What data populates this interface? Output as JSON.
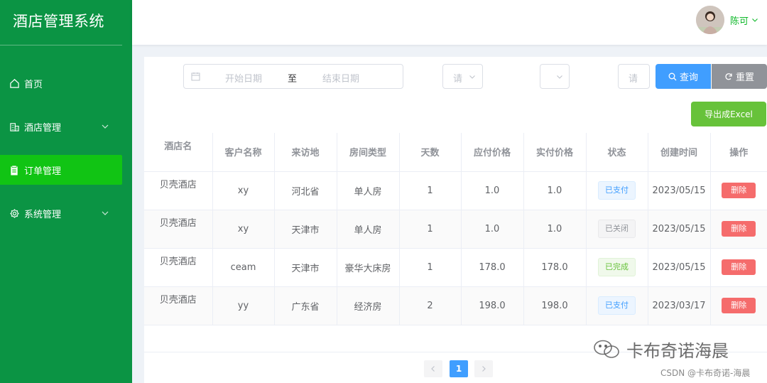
{
  "app": {
    "title": "酒店管理系统"
  },
  "sidebar": {
    "items": [
      {
        "label": "首页",
        "icon": "home-icon",
        "active": false,
        "expandable": false
      },
      {
        "label": "酒店管理",
        "icon": "building-icon",
        "active": false,
        "expandable": true
      },
      {
        "label": "订单管理",
        "icon": "clipboard-icon",
        "active": true,
        "expandable": false
      },
      {
        "label": "系统管理",
        "icon": "gear-icon",
        "active": false,
        "expandable": true
      }
    ]
  },
  "header": {
    "username": "陈可"
  },
  "filters": {
    "start_placeholder": "开始日期",
    "range_separator": "至",
    "end_placeholder": "结束日期",
    "select1_placeholder": "请",
    "input_placeholder": "请",
    "search_label": "查询",
    "reset_label": "重置",
    "export_label": "导出成Excel"
  },
  "table": {
    "headers": [
      "酒店名",
      "客户名称",
      "来访地",
      "房间类型",
      "天数",
      "应付价格",
      "实付价格",
      "状态",
      "创建时间",
      "操作"
    ],
    "rows": [
      {
        "hotel": "贝壳酒店",
        "customer": "xy",
        "origin": "河北省",
        "room": "单人房",
        "days": "1",
        "due": "1.0",
        "paid": "1.0",
        "status": "已支付",
        "status_kind": "paid",
        "created": "2023/05/15",
        "action": "删除"
      },
      {
        "hotel": "贝壳酒店",
        "customer": "xy",
        "origin": "天津市",
        "room": "单人房",
        "days": "1",
        "due": "1.0",
        "paid": "1.0",
        "status": "已关闭",
        "status_kind": "closed",
        "created": "2023/05/15",
        "action": "删除"
      },
      {
        "hotel": "贝壳酒店",
        "customer": "ceam",
        "origin": "天津市",
        "room": "豪华大床房",
        "days": "1",
        "due": "178.0",
        "paid": "178.0",
        "status": "已完成",
        "status_kind": "done",
        "created": "2023/05/15",
        "action": "删除"
      },
      {
        "hotel": "贝壳酒店",
        "customer": "yy",
        "origin": "广东省",
        "room": "经济房",
        "days": "2",
        "due": "198.0",
        "paid": "198.0",
        "status": "已支付",
        "status_kind": "paid",
        "created": "2023/03/17",
        "action": "删除"
      }
    ]
  },
  "pagination": {
    "current": "1",
    "prev_icon": "chevron-left-icon",
    "next_icon": "chevron-right-icon"
  },
  "watermark": {
    "main": "卡布奇诺海晨",
    "sub": "CSDN @卡布奇诺-海晨"
  },
  "colors": {
    "sidebar_bg": "#0b9444",
    "active_menu": "#11c414",
    "primary": "#409eff",
    "success": "#67c23a",
    "danger": "#f56c6c",
    "info": "#909399"
  }
}
